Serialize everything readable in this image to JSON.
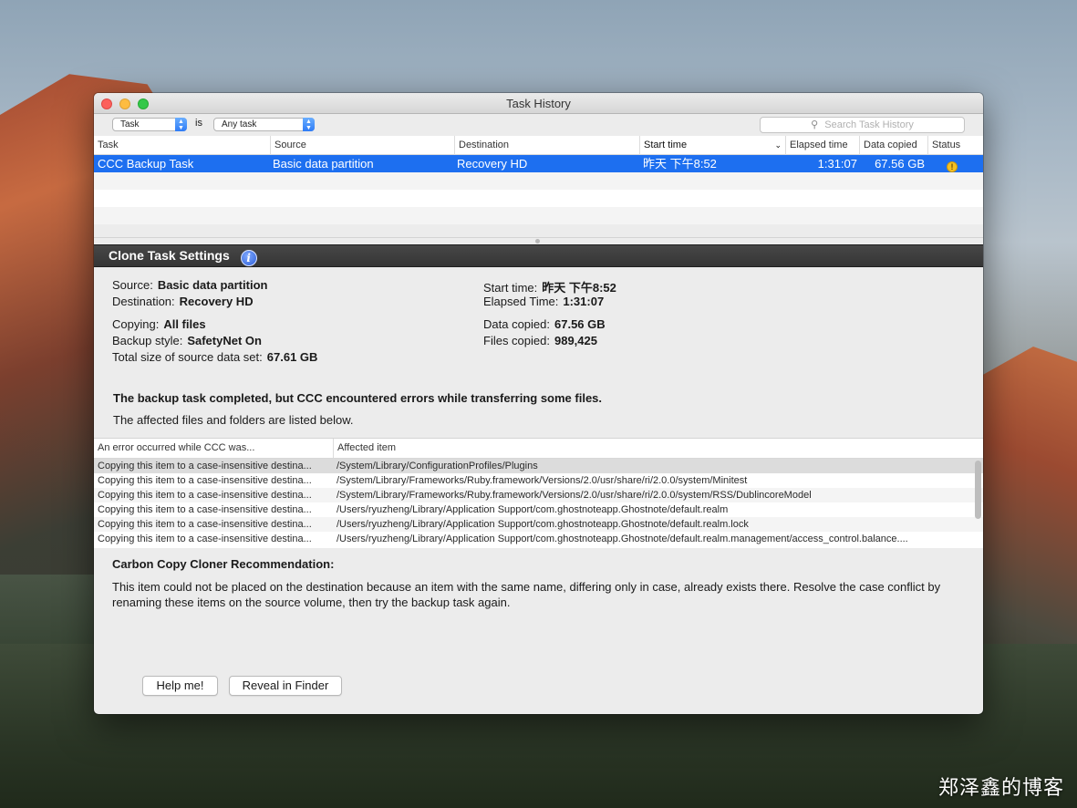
{
  "window": {
    "title": "Task History"
  },
  "filter": {
    "field": "Task",
    "operator": "is",
    "value": "Any task",
    "search_placeholder": "Search Task History"
  },
  "task_table": {
    "columns": [
      "Task",
      "Source",
      "Destination",
      "Start time",
      "Elapsed time",
      "Data copied",
      "Status"
    ],
    "sort_column": "Start time",
    "rows": [
      {
        "task": "CCC Backup Task",
        "source": "Basic data partition",
        "destination": "Recovery HD",
        "start_time": "昨天 下午8:52",
        "elapsed": "1:31:07",
        "data_copied": "67.56 GB",
        "status": "warning",
        "selected": true
      }
    ]
  },
  "settings": {
    "title": "Clone Task Settings",
    "source_label": "Source:",
    "source": "Basic data partition",
    "destination_label": "Destination:",
    "destination": "Recovery HD",
    "copying_label": "Copying:",
    "copying": "All files",
    "backup_style_label": "Backup style:",
    "backup_style": "SafetyNet On",
    "total_size_label": "Total size of source data set:",
    "total_size": "67.61 GB",
    "start_time_label": "Start time:",
    "start_time": "昨天 下午8:52",
    "elapsed_label": "Elapsed Time:",
    "elapsed": "1:31:07",
    "data_copied_label": "Data copied:",
    "data_copied": "67.56 GB",
    "files_copied_label": "Files copied:",
    "files_copied": "989,425",
    "summary": "The backup task completed, but CCC encountered errors while transferring some files.",
    "summary_detail": "The affected files and folders are listed below."
  },
  "error_table": {
    "columns": [
      "An error occurred while CCC was...",
      "Affected item"
    ],
    "rows": [
      {
        "error": "Copying this item to a case-insensitive destina...",
        "item": "/System/Library/ConfigurationProfiles/Plugins"
      },
      {
        "error": "Copying this item to a case-insensitive destina...",
        "item": "/System/Library/Frameworks/Ruby.framework/Versions/2.0/usr/share/ri/2.0.0/system/Minitest"
      },
      {
        "error": "Copying this item to a case-insensitive destina...",
        "item": "/System/Library/Frameworks/Ruby.framework/Versions/2.0/usr/share/ri/2.0.0/system/RSS/DublincoreModel"
      },
      {
        "error": "Copying this item to a case-insensitive destina...",
        "item": "/Users/ryuzheng/Library/Application Support/com.ghostnoteapp.Ghostnote/default.realm"
      },
      {
        "error": "Copying this item to a case-insensitive destina...",
        "item": "/Users/ryuzheng/Library/Application Support/com.ghostnoteapp.Ghostnote/default.realm.lock"
      },
      {
        "error": "Copying this item to a case-insensitive destina...",
        "item": "/Users/ryuzheng/Library/Application Support/com.ghostnoteapp.Ghostnote/default.realm.management/access_control.balance...."
      }
    ]
  },
  "recommendation": {
    "title": "Carbon Copy Cloner Recommendation:",
    "body": "This item could not be placed on the destination because an item with the same name, differing only in case, already exists there. Resolve the case conflict by renaming these items on the source volume, then try the backup task again."
  },
  "buttons": {
    "help": "Help me!",
    "reveal": "Reveal in Finder"
  },
  "watermark": "郑泽鑫的博客",
  "colors": {
    "selection": "#1d6ff0",
    "warning": "#f5c023",
    "section_bar": "#3d3d3d"
  }
}
